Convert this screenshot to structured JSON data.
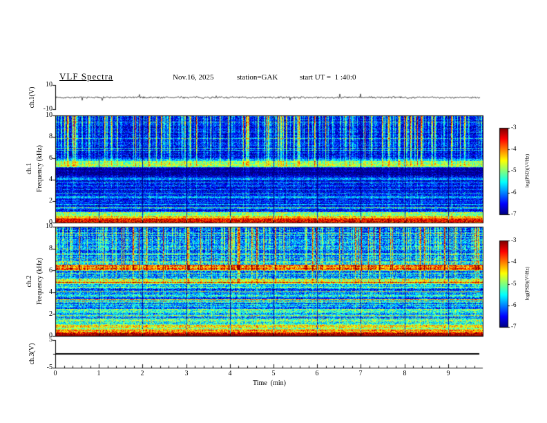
{
  "header": {
    "title": "VLF Spectra",
    "date": "Nov.16, 2025",
    "station": "station=GAK",
    "start_ut": "start UT =  1 :40:0"
  },
  "panels": {
    "ch1_wave": {
      "label": "ch.1(V)"
    },
    "spec": {
      "ylabel": "Frequency (kHz)"
    },
    "spec1": {
      "label": "ch.1"
    },
    "spec2": {
      "label": "ch.2"
    },
    "ch3": {
      "label": "ch.3(V)"
    }
  },
  "axes": {
    "wave_ticks": {
      "top": "10",
      "bottom": "-10"
    },
    "spec_y_ticks": [
      "10",
      "8",
      "6",
      "4",
      "2",
      "0"
    ],
    "ch3_ticks": {
      "top": "5",
      "bottom": "-5"
    },
    "x_tick_labels": [
      "0",
      "1",
      "2",
      "3",
      "4",
      "5",
      "6",
      "7",
      "8",
      "9"
    ],
    "x_label": "Time  (min)",
    "cbar_ticks": [
      "-3",
      "-4",
      "-5",
      "-6",
      "-7"
    ],
    "cbar_label": "log(PSD)(V²/Hz)"
  },
  "chart_data": [
    {
      "panel": "ch1_waveform",
      "type": "line",
      "ylabel": "ch.1(V)",
      "ylim": [
        -10,
        10
      ],
      "xlim_min": [
        0,
        9.83
      ],
      "description": "Channel 1 VLF voltage vs time: continuous ~±1 V broadband noise about 0 V with sporadic impulsive spikes reaching ~±4 V",
      "render": {
        "seed": 7,
        "noise_v": 0.75,
        "spike_prob": 0.012,
        "spike_v": [
          1.5,
          4.0
        ],
        "neg_bias": 0.6
      }
    },
    {
      "panel": "ch1_spectrogram",
      "type": "heatmap",
      "ylabel": "Frequency (kHz)",
      "ylim_khz": [
        0,
        10
      ],
      "xlim_min": [
        0,
        9.83
      ],
      "colorbar": {
        "label": "log(PSD)(V²/Hz)",
        "range": [
          -7,
          -3
        ],
        "colormap": "jet"
      },
      "description": "Dense vertical sferic streaks above ~5 kHz (cyan/green/yellow on near-black blue), bright cyan band 5.2-6 kHz, darker band 4.4-5.2 kHz, faint horizontal harmonic lines 1-4.5 kHz on dark blue, intense red/yellow hum band below ~1 kHz, thin dark gaps at each minute boundary",
      "render": {
        "seed": 101,
        "base": -6.55,
        "noise": 0.55,
        "row_stripe_amp": 0.25,
        "row_line_prob": 0.06,
        "row_line_boost": 0.75,
        "streak_min_freq": 5.0,
        "streak_bleed": 0.12,
        "col_major_prob": 0.1,
        "col_major_amp": [
          1.8,
          3.2
        ],
        "col_minor_prob": 0.3,
        "col_minor_amp": [
          0.2,
          1.4
        ],
        "bands": [
          {
            "f0": 0.0,
            "f1": 0.35,
            "dv": 2.9
          },
          {
            "f0": 0.35,
            "f1": 0.6,
            "dv": 2.2
          },
          {
            "f0": 0.6,
            "f1": 0.95,
            "dv": 1.5
          },
          {
            "f0": 4.4,
            "f1": 5.15,
            "dv": -0.5
          },
          {
            "f0": 5.2,
            "f1": 5.75,
            "dv": 1.6
          },
          {
            "f0": 5.75,
            "f1": 6.05,
            "dv": 0.6
          }
        ],
        "lines": [
          1.0,
          1.35,
          1.7,
          2.05,
          2.4,
          2.75,
          3.1,
          3.45,
          3.8,
          4.15
        ],
        "line_boost": 0.55,
        "minute_gap_darken": 1.6
      }
    },
    {
      "panel": "ch2_spectrogram",
      "type": "heatmap",
      "ylabel": "Frequency (kHz)",
      "ylim_khz": [
        0,
        10
      ],
      "xlim_min": [
        0,
        9.83
      ],
      "colorbar": {
        "label": "log(PSD)(V²/Hz)",
        "range": [
          -7,
          -3
        ],
        "colormap": "jet"
      },
      "description": "Brighter blue-green background with strong horizontal banding at all frequencies, vertical sferic streaks above ~4.5 kHz, bright yellow-green bands near 5 kHz and 6.1-6.6 kHz, cyan band 2.1-2.5 kHz, intense red/yellow hum below ~1.6 kHz, thin dark gaps at each minute boundary",
      "render": {
        "seed": 202,
        "base": -6.1,
        "noise": 0.7,
        "row_stripe_amp": 0.45,
        "row_line_prob": 0.1,
        "row_line_boost": 0.9,
        "streak_min_freq": 4.5,
        "streak_bleed": 0.15,
        "col_major_prob": 0.09,
        "col_major_amp": [
          1.6,
          3.0
        ],
        "col_minor_prob": 0.35,
        "col_minor_amp": [
          0.2,
          1.3
        ],
        "bands": [
          {
            "f0": 0.0,
            "f1": 0.3,
            "dv": 2.7
          },
          {
            "f0": 0.3,
            "f1": 0.55,
            "dv": 1.9
          },
          {
            "f0": 0.55,
            "f1": 1.0,
            "dv": 1.3
          },
          {
            "f0": 1.0,
            "f1": 1.6,
            "dv": 0.9
          },
          {
            "f0": 2.1,
            "f1": 2.5,
            "dv": 0.8
          },
          {
            "f0": 4.85,
            "f1": 5.2,
            "dv": 1.2
          },
          {
            "f0": 6.05,
            "f1": 6.55,
            "dv": 1.9
          },
          {
            "f0": 6.55,
            "f1": 6.9,
            "dv": 0.7
          }
        ],
        "lines": [
          1.9,
          2.9,
          3.3,
          3.7,
          4.1,
          4.5,
          5.6,
          7.1,
          7.5,
          8.0,
          8.5,
          9.0,
          9.5
        ],
        "line_boost": 0.6,
        "minute_gap_darken": 1.2
      }
    },
    {
      "panel": "ch3_waveform",
      "type": "line",
      "ylabel": "ch.3(V)",
      "ylim": [
        -5,
        5
      ],
      "xlim_min": [
        0,
        9.83
      ],
      "description": "Channel 3 voltage vs time: flat line at 0 V for the whole interval",
      "render": {
        "value": 0
      }
    }
  ]
}
